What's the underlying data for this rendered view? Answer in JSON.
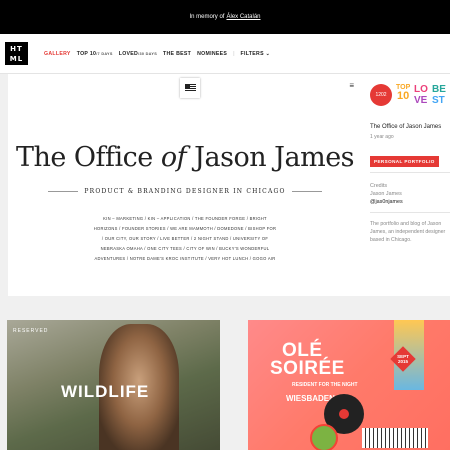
{
  "topbar": {
    "memory_text": "In memory of",
    "memory_name": "Álex Catalán"
  },
  "logo": {
    "line1": "HT",
    "line2": "ML"
  },
  "nav": {
    "gallery": "GALLERY",
    "top": "TOP 10",
    "top_sub": "/7 DAYS",
    "loved": "LOVED",
    "loved_sub": "/30 DAYS",
    "best": "THE BEST",
    "nominees": "NOMINEES",
    "filters": "FILTERS"
  },
  "hero": {
    "title_1": "The Office ",
    "title_of": "of",
    "title_2": " Jason James",
    "subtitle": "PRODUCT & BRANDING DESIGNER IN CHICAGO",
    "clients": "KIN – MARKETING / KIN – APPLICATION / THE FOUNDER FORGE / BRIGHT HORIZONS / FOUNDER STORIES / WE ARE MAMMOTH / DOMEDONE / BISHOP FOR / OUR CITY, OUR STORY / LIVE BETTER / 2 NIGHT STAND / UNIVERSITY OF NEBRASKA OMAHA / ONE CITY TEES / CITY OF WIN / BUCKY'S WONDERFUL ADVENTURES / NOTRE DAME'S KROC INSTITUTE / VERY HOT LUNCH / GOGO AIR"
  },
  "sidebar": {
    "badge_heart": "1202",
    "badge_top": "TOP",
    "badge_top_num": "10",
    "badge_love_1": "LO",
    "badge_love_2": "VE",
    "badge_best_1": "BE",
    "badge_best_2": "ST",
    "project_title": "The Office of Jason James",
    "project_date": "1 year ago",
    "tag": "PERSONAL PORTFOLIO",
    "credits_label": "Credits",
    "credits_name": "Jason James",
    "credits_handle": "@jas0njames",
    "description": "The portfolio and blog of Jason James, an independent designer based in Chicago."
  },
  "cards": {
    "card1": {
      "reserved": "RESERVED",
      "title": "WILDLIFE"
    },
    "card2": {
      "title_1": "OLÉ",
      "title_2": "SOIRÉE",
      "sub": "RESIDENT FOR THE NIGHT",
      "city": "WIESBADEN",
      "badge": "SEPT 2015"
    }
  },
  "colors": {
    "accent": "#e53935",
    "topbar": "#000000"
  },
  "icons": {
    "menu": "menu-icon",
    "flag": "flag-icon",
    "chevron": "chevron-down-icon"
  }
}
